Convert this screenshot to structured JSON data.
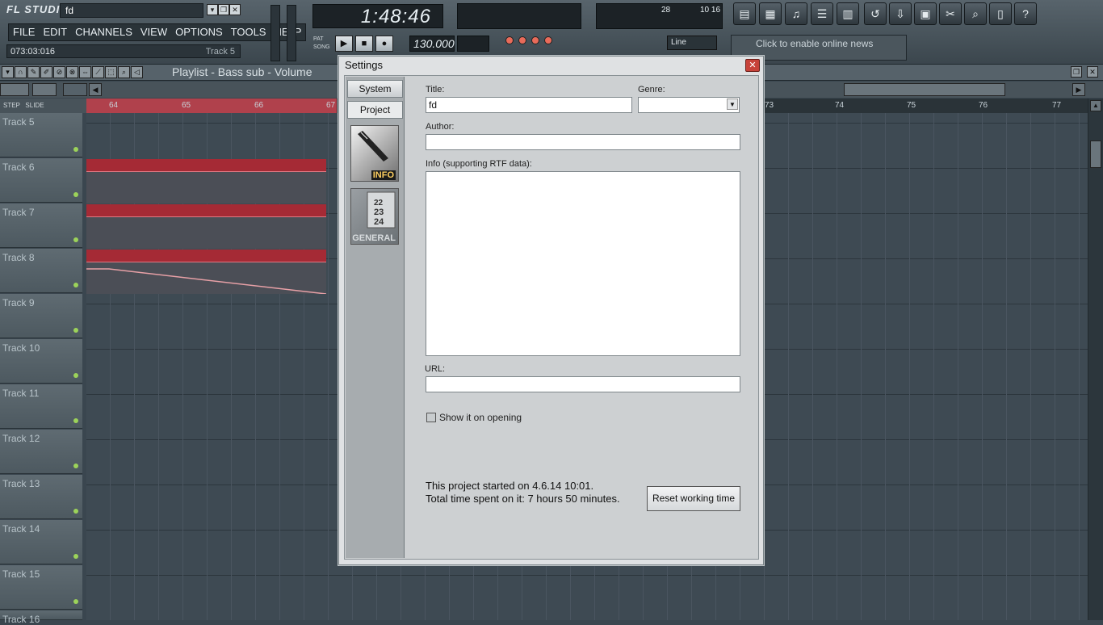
{
  "app": {
    "logo": "FL STUDIO",
    "project_name": "fd",
    "menu": [
      "FILE",
      "EDIT",
      "CHANNELS",
      "VIEW",
      "OPTIONS",
      "TOOLS",
      "HELP"
    ],
    "hint_time": "073:03:016",
    "hint_track": "Track 5",
    "song_time": "1:48:46",
    "tempo": "130.000",
    "snap_mode": "Line",
    "cpu_label": "28",
    "poly_label": "10 16",
    "news_text": "Click to enable online news",
    "pat_label": "PAT",
    "song_label": "SONG"
  },
  "playlist": {
    "title": "Playlist - Bass sub - Volume",
    "step_label": "STEP",
    "slide_label": "SLIDE",
    "ruler_ticks": [
      "64",
      "65",
      "66",
      "67",
      "73",
      "74",
      "75",
      "76",
      "77"
    ],
    "tracks": [
      "Track 5",
      "Track 6",
      "Track 7",
      "Track 8",
      "Track 9",
      "Track 10",
      "Track 11",
      "Track 12",
      "Track 13",
      "Track 14",
      "Track 15",
      "Track 16"
    ]
  },
  "dialog": {
    "title": "Settings",
    "tabs": [
      "System",
      "Project"
    ],
    "side_icons": [
      "INFO",
      "GENERAL"
    ],
    "fields": {
      "title_label": "Title:",
      "title_value": "fd",
      "genre_label": "Genre:",
      "genre_value": "",
      "author_label": "Author:",
      "author_value": "",
      "info_label": "Info (supporting RTF data):",
      "info_value": "",
      "url_label": "URL:",
      "url_value": ""
    },
    "show_on_opening": "Show it on opening",
    "started_text": "This project started on 4.6.14 10:01.",
    "total_time_text": "Total time spent on it: 7 hours 50 minutes.",
    "reset_button": "Reset working time"
  }
}
